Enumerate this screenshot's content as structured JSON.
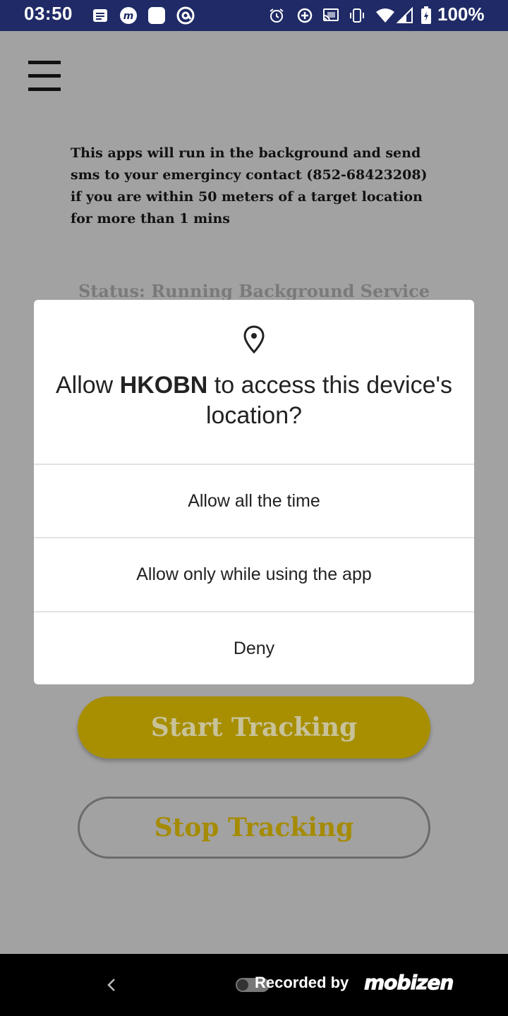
{
  "status_bar": {
    "time": "03:50",
    "battery": "100%",
    "icons": [
      "notification-list-icon",
      "m-app-icon",
      "blank-square-icon",
      "at-circle-icon",
      "alarm-icon",
      "data-saver-icon",
      "cast-icon",
      "vibrate-icon",
      "wifi-icon",
      "cell-signal-icon",
      "battery-icon"
    ]
  },
  "app": {
    "info_text": "This apps will run in the background and send sms to your emergincy contact (852-68423208) if you are within 50 meters of a target location for more than 1 mins",
    "status": "Status: Running Background Service",
    "start_button": "Start Tracking",
    "stop_button": "Stop Tracking"
  },
  "dialog": {
    "title_prefix": "Allow ",
    "app_name": "HKOBN",
    "title_suffix": " to access this device's location?",
    "options": [
      "Allow all the time",
      "Allow only while using the app",
      "Deny"
    ]
  },
  "navbar": {
    "recorded_by": "Recorded by",
    "logo": "mobizen"
  },
  "colors": {
    "status_bar": "#1f2a66",
    "scrim": "#a2a2a2",
    "accent_gold": "#a78f01",
    "dialog_bg": "#ffffff"
  }
}
